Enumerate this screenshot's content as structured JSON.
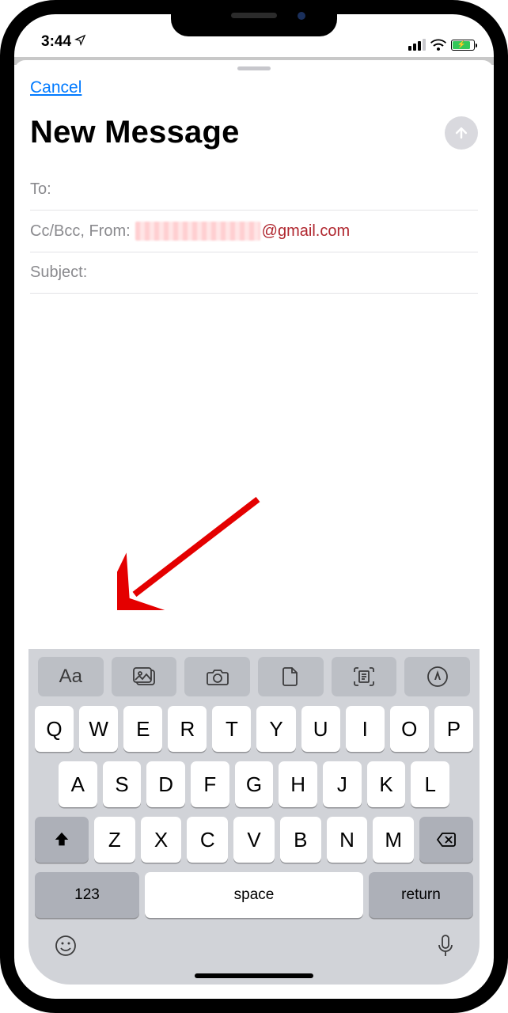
{
  "status": {
    "time": "3:44",
    "location_icon": "location-arrow"
  },
  "modal": {
    "cancel": "Cancel",
    "title": "New Message",
    "send_icon": "arrow-up"
  },
  "fields": {
    "to_label": "To:",
    "to_value": "",
    "ccbcc_label": "Cc/Bcc, From:",
    "from_domain": "@gmail.com",
    "subject_label": "Subject:",
    "subject_value": ""
  },
  "toolbar": {
    "format_label": "Aa",
    "photos_icon": "photos",
    "camera_icon": "camera",
    "file_icon": "document",
    "scan_icon": "scan",
    "markup_icon": "markup"
  },
  "keyboard": {
    "rows": [
      [
        "Q",
        "W",
        "E",
        "R",
        "T",
        "Y",
        "U",
        "I",
        "O",
        "P"
      ],
      [
        "A",
        "S",
        "D",
        "F",
        "G",
        "H",
        "J",
        "K",
        "L"
      ],
      [
        "Z",
        "X",
        "C",
        "V",
        "B",
        "N",
        "M"
      ]
    ],
    "numbers": "123",
    "space": "space",
    "return": "return"
  }
}
